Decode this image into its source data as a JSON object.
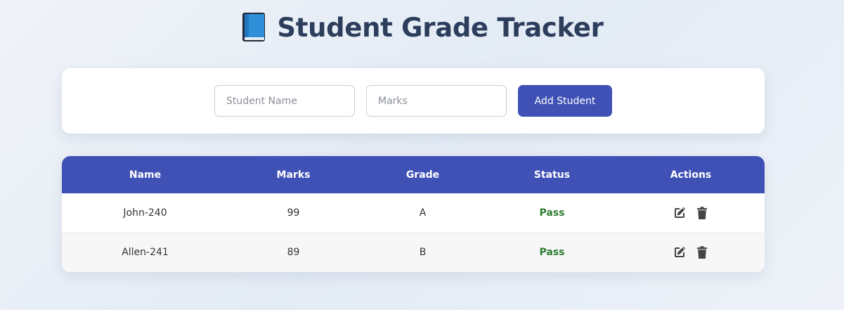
{
  "header": {
    "title": "Student Grade Tracker",
    "icon": "blue-book-icon"
  },
  "form": {
    "name_placeholder": "Student Name",
    "name_value": "",
    "marks_placeholder": "Marks",
    "marks_value": "",
    "add_label": "Add Student"
  },
  "table": {
    "columns": [
      "Name",
      "Marks",
      "Grade",
      "Status",
      "Actions"
    ],
    "rows": [
      {
        "name": "John-240",
        "marks": "99",
        "grade": "A",
        "status": "Pass"
      },
      {
        "name": "Allen-241",
        "marks": "89",
        "grade": "B",
        "status": "Pass"
      }
    ],
    "action_icons": [
      "edit-icon",
      "trash-icon"
    ]
  },
  "colors": {
    "accent": "#3f51b5",
    "title": "#2c3e5c",
    "pass": "#2e7d32"
  }
}
